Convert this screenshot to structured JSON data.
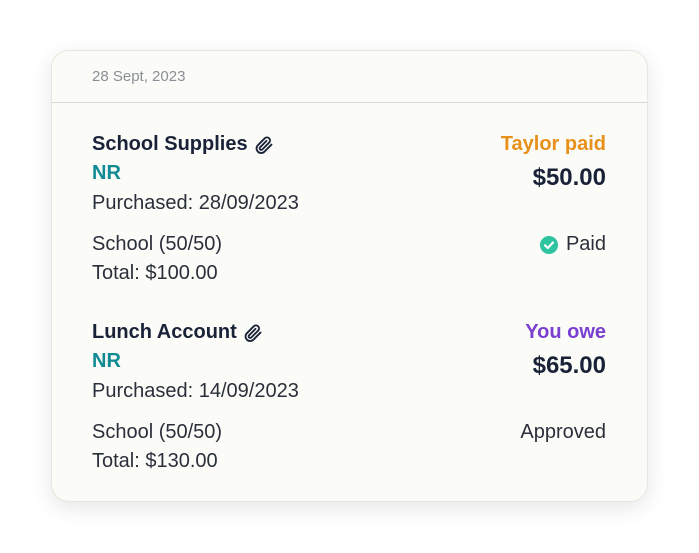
{
  "date": "28 Sept, 2023",
  "colors": {
    "initials": "#108a93",
    "taylor_paid": "#e7901a",
    "you_owe": "#7a3fd0",
    "paid_check": "#2ec4a0",
    "title": "#1a2238"
  },
  "expenses": [
    {
      "title": "School Supplies",
      "attachment_icon": "paperclip-icon",
      "initials": "NR",
      "purchased": "Purchased: 28/09/2023",
      "category": "School (50/50)",
      "total": "Total: $100.00",
      "payer": "Taylor paid",
      "amount": "$50.00",
      "status": "Paid",
      "status_icon": "check-circle-icon"
    },
    {
      "title": "Lunch Account",
      "attachment_icon": "paperclip-icon",
      "initials": "NR",
      "purchased": "Purchased: 14/09/2023",
      "category": "School (50/50)",
      "total": "Total: $130.00",
      "payer": "You owe",
      "amount": "$65.00",
      "status": "Approved"
    }
  ]
}
